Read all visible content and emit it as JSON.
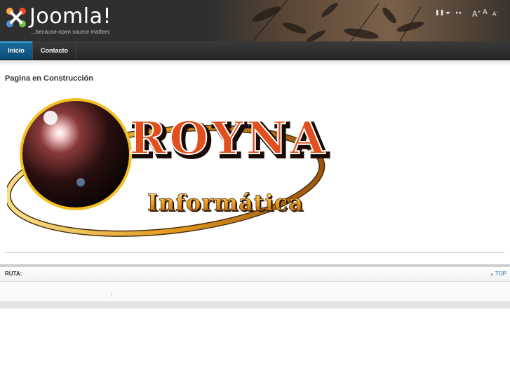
{
  "header": {
    "logo_text": "Joomla!",
    "logo_tagline": "...because open source matters",
    "tools": [
      {
        "name": "pause-icon",
        "glyph": "❚❚"
      },
      {
        "name": "rewind-icon",
        "glyph": "◂▸"
      },
      {
        "name": "fast-forward-icon",
        "glyph": "▸◂"
      },
      {
        "name": "font-increase-icon",
        "glyph": "A+"
      },
      {
        "name": "font-reset-icon",
        "glyph": "A"
      },
      {
        "name": "font-decrease-icon",
        "glyph": "A-"
      }
    ],
    "colors": {
      "background": "#2f2f2f",
      "accent": "#0b4c74"
    }
  },
  "nav": {
    "items": [
      {
        "label": "Inicio",
        "active": true
      },
      {
        "label": "Contacto",
        "active": false
      }
    ]
  },
  "main": {
    "title": "Pagina en Construcción",
    "logo": {
      "line1": "ROYNA",
      "line2": "Informática"
    }
  },
  "footer": {
    "breadcrumb_label": "RUTA:",
    "top_link": "TOP",
    "top_link_icon": "up-arrow-icon"
  }
}
